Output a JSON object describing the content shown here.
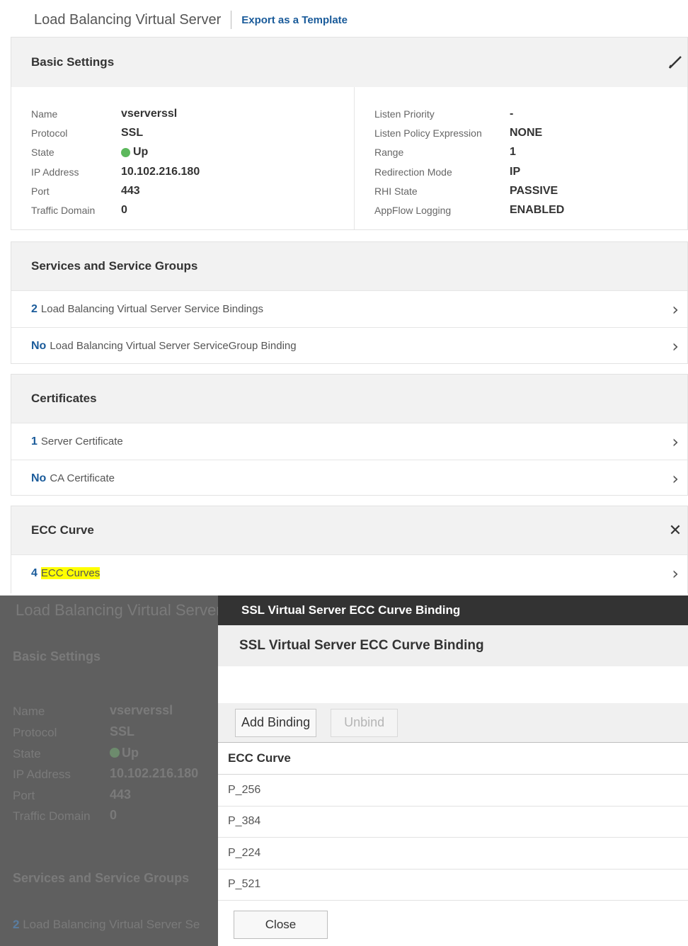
{
  "header": {
    "title": "Load Balancing Virtual Server",
    "export_link": "Export as a Template"
  },
  "basic_settings": {
    "title": "Basic Settings",
    "edit_icon": "pencil-icon",
    "left": [
      {
        "key": "Name",
        "value": "vserverssl"
      },
      {
        "key": "Protocol",
        "value": "SSL"
      },
      {
        "key": "State",
        "value": "Up",
        "status_color": "#5cb85c"
      },
      {
        "key": "IP Address",
        "value": "10.102.216.180"
      },
      {
        "key": "Port",
        "value": "443"
      },
      {
        "key": "Traffic Domain",
        "value": "0"
      }
    ],
    "right": [
      {
        "key": "Listen Priority",
        "value": "-"
      },
      {
        "key": "Listen Policy Expression",
        "value": "NONE"
      },
      {
        "key": "Range",
        "value": "1"
      },
      {
        "key": "Redirection Mode",
        "value": "IP"
      },
      {
        "key": "RHI State",
        "value": "PASSIVE"
      },
      {
        "key": "AppFlow Logging",
        "value": "ENABLED"
      }
    ]
  },
  "services": {
    "title": "Services and Service Groups",
    "rows": [
      {
        "count": "2",
        "label": "Load Balancing Virtual Server Service Bindings"
      },
      {
        "count": "No",
        "label": "Load Balancing Virtual Server ServiceGroup Binding"
      }
    ]
  },
  "certificates": {
    "title": "Certificates",
    "rows": [
      {
        "count": "1",
        "label": "Server Certificate"
      },
      {
        "count": "No",
        "label": "CA Certificate"
      }
    ]
  },
  "ecc": {
    "title": "ECC Curve",
    "close_icon": "close-icon",
    "rows": [
      {
        "count": "4",
        "label": "ECC Curves",
        "highlight": "#ffff00"
      }
    ]
  },
  "background": {
    "title": "Load Balancing Virtual Server",
    "basic_title": "Basic Settings",
    "keys": [
      "Name",
      "Protocol",
      "State",
      "IP Address",
      "Port",
      "Traffic Domain"
    ],
    "values": [
      "vserverssl",
      "SSL",
      "Up",
      "10.102.216.180",
      "443",
      "0"
    ],
    "services_title": "Services and Service Groups",
    "link_count": "2",
    "link_label": "Load Balancing Virtual Server Se"
  },
  "dialog": {
    "titlebar": "SSL Virtual Server ECC Curve Binding",
    "subtitle": "SSL Virtual Server ECC Curve Binding",
    "add_binding": "Add Binding",
    "unbind": "Unbind",
    "column_header": "ECC Curve",
    "curves": [
      "P_256",
      "P_384",
      "P_224",
      "P_521"
    ],
    "close": "Close"
  },
  "colors": {
    "link_blue": "#1a5b9a",
    "titlebar": "#333333",
    "highlight": "#ffff00",
    "status_up": "#5cb85c"
  }
}
